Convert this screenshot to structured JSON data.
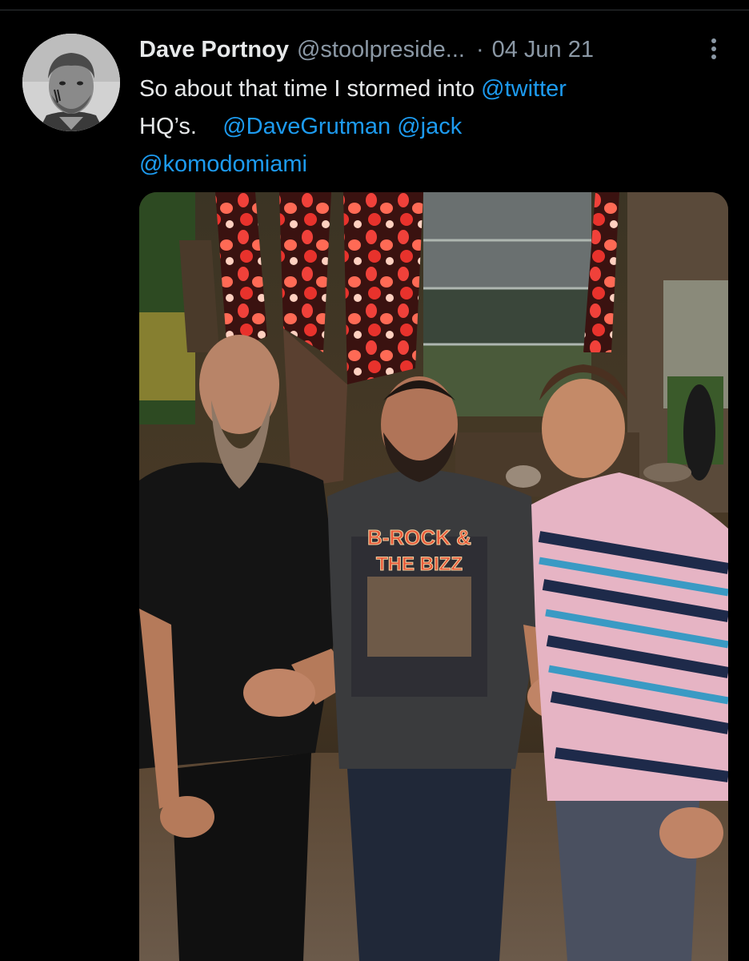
{
  "tweet": {
    "author": {
      "display_name": "Dave Portnoy",
      "handle": "@stoolpreside...",
      "avatar_icon": "profile-photo-avatar"
    },
    "separator": "·",
    "date": "04 Jun 21",
    "text": {
      "line1_prefix": "So about that time I stormed into ",
      "mention_twitter": "@twitter",
      "line2_prefix": "HQ’s.",
      "mention_grutman": "@DaveGrutman",
      "mention_jack": "@jack",
      "mention_komodo": "@komodomiami"
    },
    "more_icon": "vertical-ellipsis-icon",
    "shirt_text": {
      "line1": "B-ROCK &",
      "line2": "THE BIZZ"
    }
  },
  "colors": {
    "background": "#000000",
    "primary_text": "#e7e9ea",
    "secondary_text": "#8b98a5",
    "link": "#1d9bf0"
  }
}
